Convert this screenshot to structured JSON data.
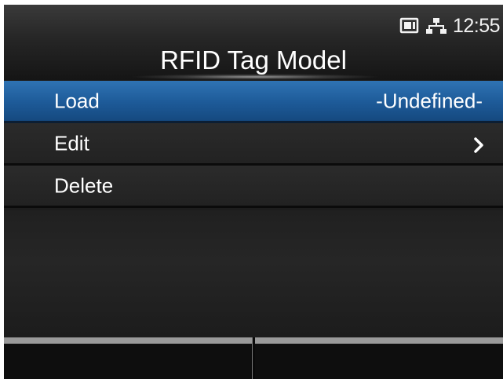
{
  "status": {
    "icons": [
      "sd-card-icon",
      "network-icon"
    ],
    "clock": "12:55"
  },
  "title": "RFID Tag Model",
  "menu": {
    "items": [
      {
        "label": "Load",
        "value": "-Undefined-",
        "selected": true
      },
      {
        "label": "Edit",
        "has_submenu": true
      },
      {
        "label": "Delete"
      }
    ]
  },
  "colors": {
    "selection": "#1d5a98",
    "background": "#1d1d1d",
    "text": "#ffffff"
  }
}
